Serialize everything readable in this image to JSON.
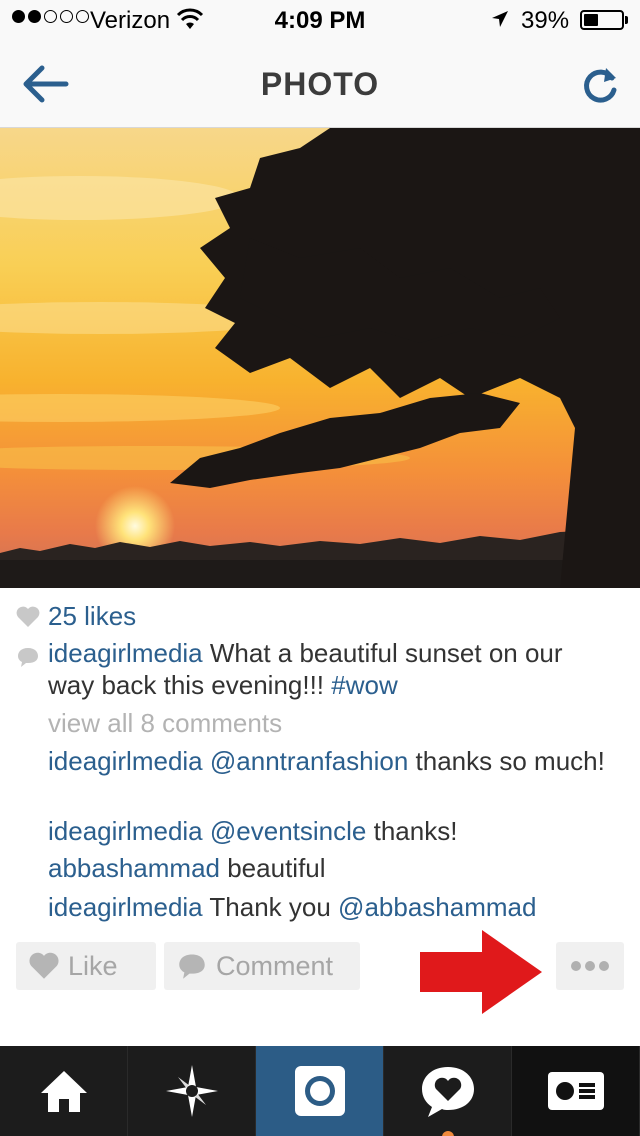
{
  "status_bar": {
    "carrier": "Verizon",
    "time": "4:09 PM",
    "battery_percent_label": "39%",
    "battery_level": 0.39,
    "signal_bars_filled": 2,
    "signal_bars_total": 5
  },
  "nav": {
    "title": "PHOTO"
  },
  "post": {
    "likes": "25 likes",
    "caption": {
      "user": "ideagirlmedia",
      "text_1": " What a beautiful sunset on our way back this evening!!! ",
      "hashtag": "#wow"
    },
    "view_all_comments": "view all 8 comments",
    "comments": [
      {
        "user": "ideagirlmedia",
        "mention": "@anntranfashion",
        "text": " thanks so much!"
      },
      {
        "user": "ideagirlmedia",
        "mention": "@eventsincle",
        "text": " thanks!"
      },
      {
        "user": "abbashammad",
        "mention": "",
        "text": " beautiful"
      },
      {
        "user": "ideagirlmedia",
        "text_before": " Thank you ",
        "mention": "@abbashammad"
      }
    ]
  },
  "actions": {
    "like_label": "Like",
    "comment_label": "Comment"
  },
  "colors": {
    "link_blue": "#2b5f8e",
    "active_tab": "#2c5c86",
    "arrow_red": "#e0191b"
  }
}
